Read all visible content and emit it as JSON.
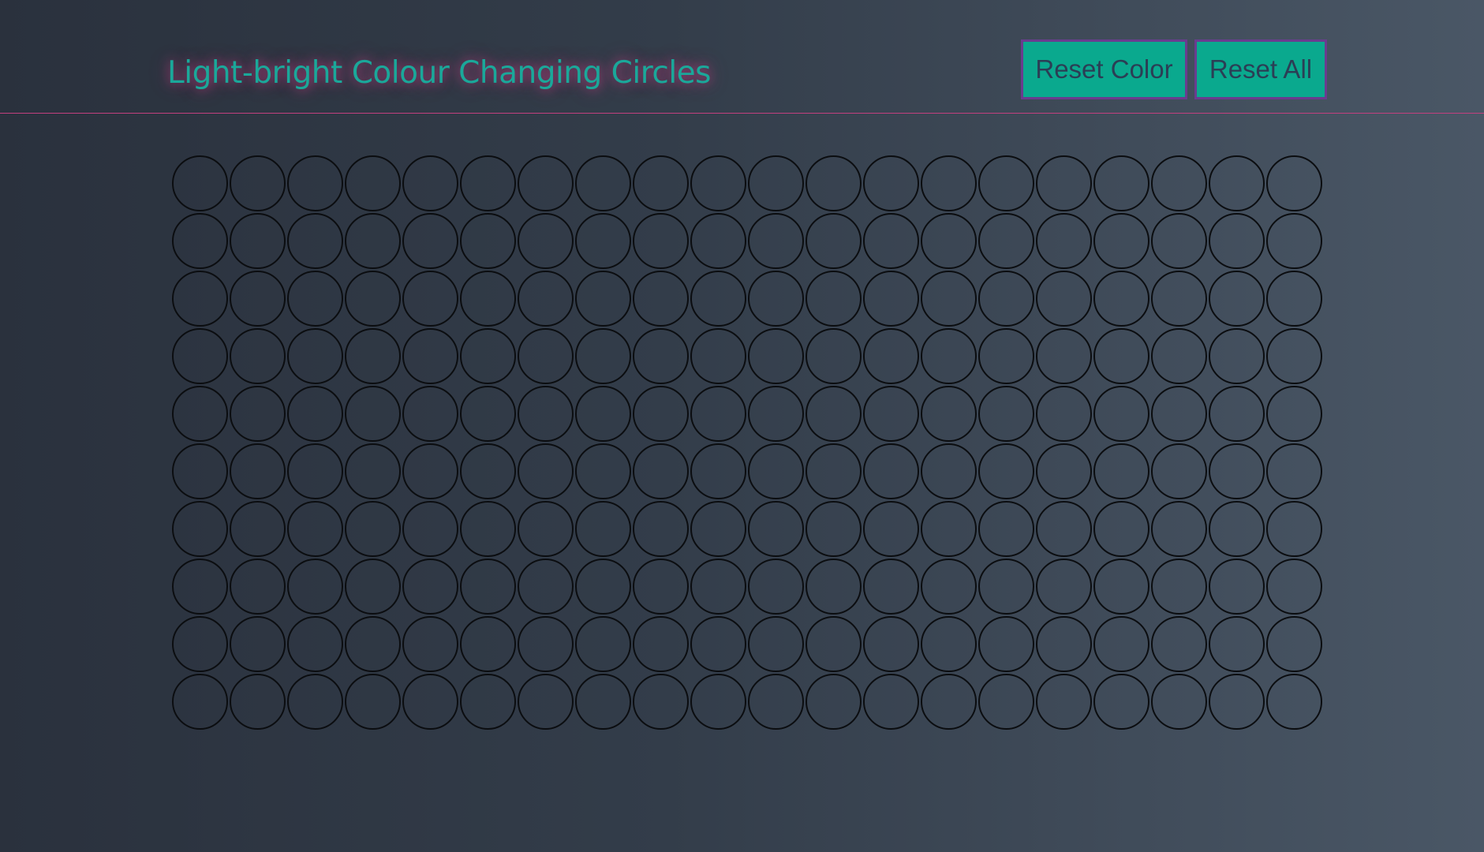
{
  "header": {
    "title": "Light-bright Colour Changing Circles",
    "buttons": {
      "reset_color": "Reset Color",
      "reset_all": "Reset All"
    }
  },
  "colors": {
    "title_text": "#1aa89a",
    "title_glow": "#c83c82",
    "button_background": "#0aa98e",
    "button_border": "#6a3c8f",
    "button_text": "#2b3e55",
    "header_divider": "#c2407f",
    "circle_outline": "#0b0d10"
  },
  "grid": {
    "rows": 10,
    "columns": 20
  }
}
